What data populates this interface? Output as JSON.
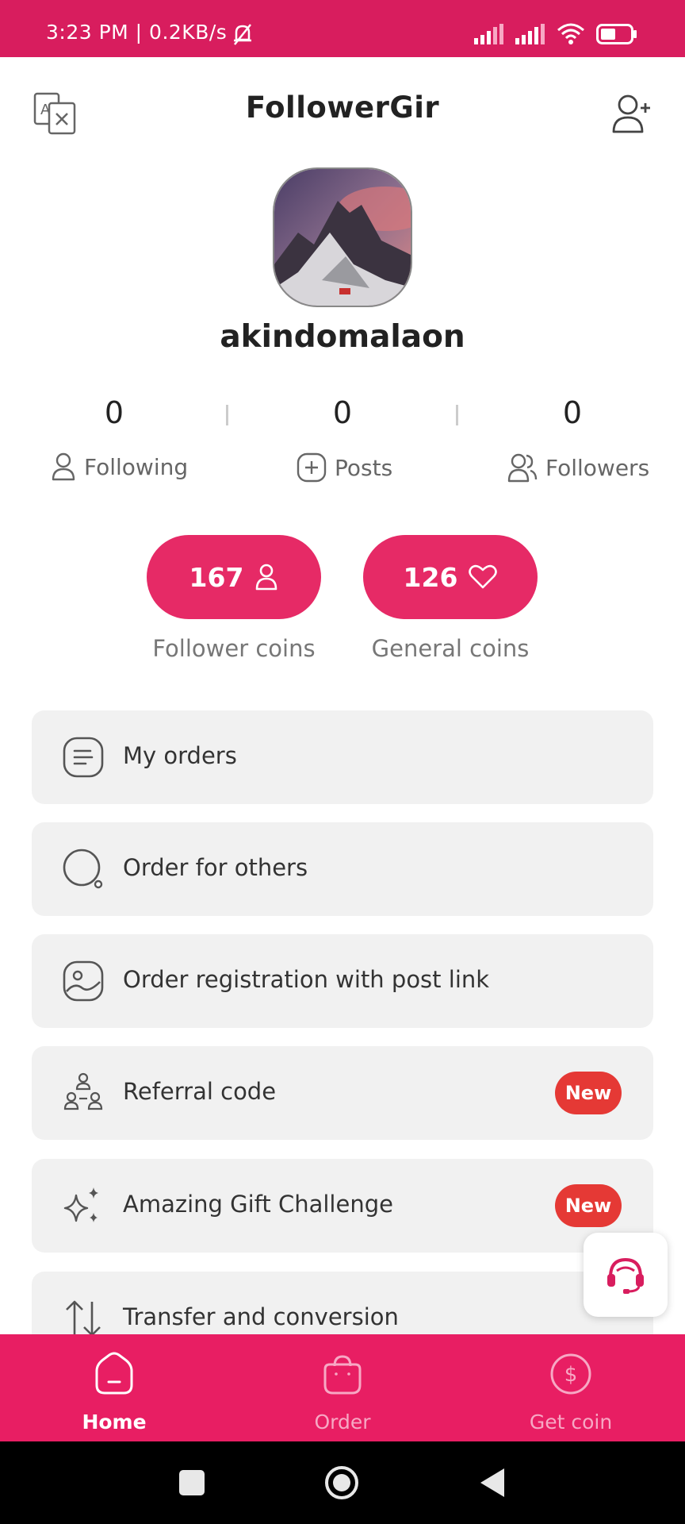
{
  "status_bar": {
    "time": "3:23 PM | 0.2KB/s"
  },
  "header": {
    "title": "FollowerGir"
  },
  "profile": {
    "username": "akindomalaon"
  },
  "stats": [
    {
      "value": "0",
      "label": "Following"
    },
    {
      "value": "0",
      "label": "Posts"
    },
    {
      "value": "0",
      "label": "Followers"
    }
  ],
  "coins": [
    {
      "value": "167",
      "label": "Follower coins"
    },
    {
      "value": "126",
      "label": "General coins"
    }
  ],
  "menu": [
    {
      "label": "My orders"
    },
    {
      "label": "Order for others"
    },
    {
      "label": "Order registration with post link"
    },
    {
      "label": "Referral code",
      "badge": "New"
    },
    {
      "label": "Amazing Gift Challenge",
      "badge": "New"
    },
    {
      "label": "Transfer and conversion"
    }
  ],
  "bottom_nav": [
    {
      "label": "Home",
      "active": true
    },
    {
      "label": "Order"
    },
    {
      "label": "Get coin"
    }
  ],
  "colors": {
    "brand": "#e81e63",
    "status_bar": "#d81d5e",
    "badge": "#e53935"
  }
}
